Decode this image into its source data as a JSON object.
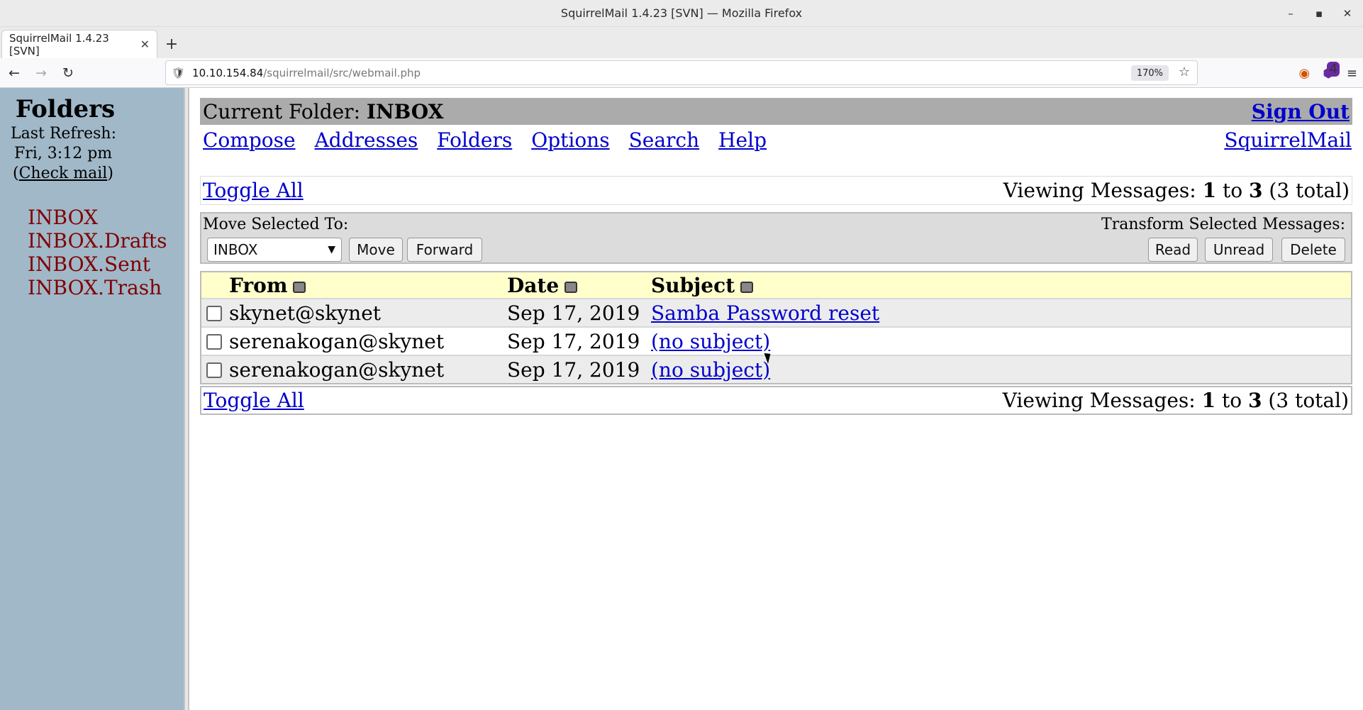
{
  "window": {
    "title": "SquirrelMail 1.4.23 [SVN] — Mozilla Firefox",
    "controls": {
      "minimize": "–",
      "maximize": "▪",
      "close": "✕"
    }
  },
  "tab": {
    "title": "SquirrelMail 1.4.23 [SVN]",
    "close": "✕",
    "new_tab": "+"
  },
  "nav": {
    "back": "←",
    "forward": "→",
    "reload": "↻",
    "security_icon": "🛡",
    "url_host": "10.10.154.84",
    "url_path": "/squirrelmail/src/webmail.php",
    "zoom": "170%",
    "star": "☆",
    "extension_badge": "4",
    "menu": "≡"
  },
  "sidebar": {
    "title": "Folders",
    "last_refresh_label": "Last Refresh:",
    "refresh_time": "Fri, 3:12 pm",
    "check_mail_open": "(",
    "check_mail_label": "Check mail",
    "check_mail_close": ")",
    "folders": [
      "INBOX",
      "INBOX.Drafts",
      "INBOX.Sent",
      "INBOX.Trash"
    ]
  },
  "main": {
    "current_folder_label": "Current Folder:",
    "current_folder": "INBOX",
    "sign_out": "Sign Out",
    "menu": {
      "compose": "Compose",
      "addresses": "Addresses",
      "folders": "Folders",
      "options": "Options",
      "search": "Search",
      "help": "Help",
      "brand": "SquirrelMail"
    },
    "toggle_all": "Toggle All",
    "viewing": {
      "prefix": "Viewing Messages:",
      "from": "1",
      "to_word": "to",
      "to": "3",
      "total": "(3 total)"
    },
    "actions": {
      "move_label": "Move Selected To:",
      "selected_folder": "INBOX",
      "move": "Move",
      "forward": "Forward",
      "transform_label": "Transform Selected Messages:",
      "read": "Read",
      "unread": "Unread",
      "delete": "Delete"
    },
    "table": {
      "headers": {
        "from": "From",
        "date": "Date",
        "subject": "Subject"
      },
      "rows": [
        {
          "from": "skynet@skynet",
          "date": "Sep 17, 2019",
          "subject": "Samba Password reset"
        },
        {
          "from": "serenakogan@skynet",
          "date": "Sep 17, 2019",
          "subject": "(no subject)"
        },
        {
          "from": "serenakogan@skynet",
          "date": "Sep 17, 2019",
          "subject": "(no subject)"
        }
      ]
    }
  }
}
